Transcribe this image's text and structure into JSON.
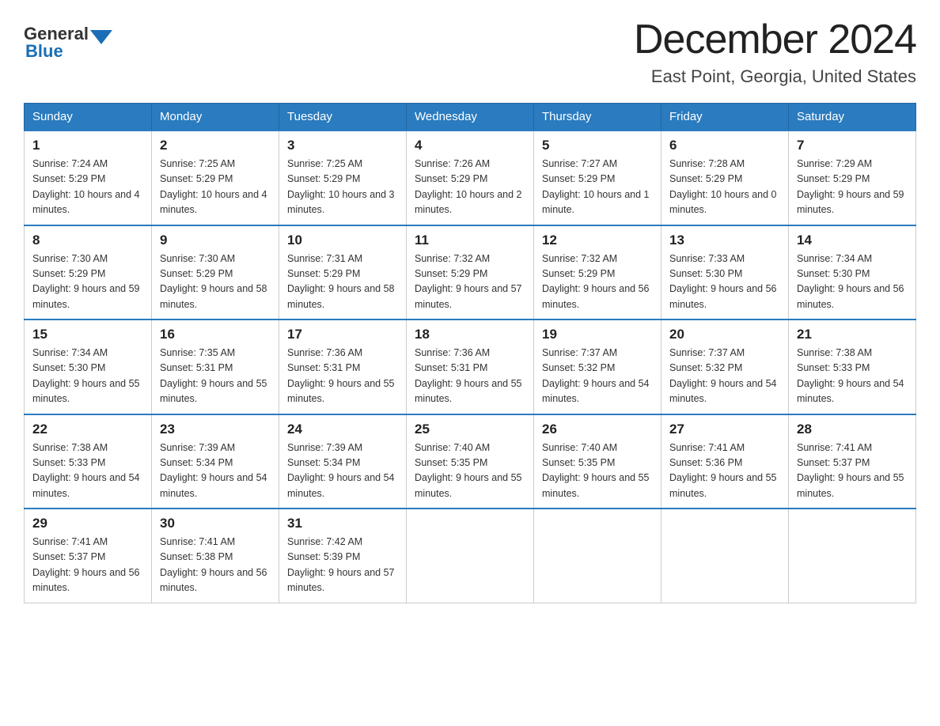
{
  "header": {
    "logo_general": "General",
    "logo_blue": "Blue",
    "month_title": "December 2024",
    "location": "East Point, Georgia, United States"
  },
  "days_of_week": [
    "Sunday",
    "Monday",
    "Tuesday",
    "Wednesday",
    "Thursday",
    "Friday",
    "Saturday"
  ],
  "weeks": [
    [
      {
        "day": "1",
        "sunrise": "7:24 AM",
        "sunset": "5:29 PM",
        "daylight": "10 hours and 4 minutes."
      },
      {
        "day": "2",
        "sunrise": "7:25 AM",
        "sunset": "5:29 PM",
        "daylight": "10 hours and 4 minutes."
      },
      {
        "day": "3",
        "sunrise": "7:25 AM",
        "sunset": "5:29 PM",
        "daylight": "10 hours and 3 minutes."
      },
      {
        "day": "4",
        "sunrise": "7:26 AM",
        "sunset": "5:29 PM",
        "daylight": "10 hours and 2 minutes."
      },
      {
        "day": "5",
        "sunrise": "7:27 AM",
        "sunset": "5:29 PM",
        "daylight": "10 hours and 1 minute."
      },
      {
        "day": "6",
        "sunrise": "7:28 AM",
        "sunset": "5:29 PM",
        "daylight": "10 hours and 0 minutes."
      },
      {
        "day": "7",
        "sunrise": "7:29 AM",
        "sunset": "5:29 PM",
        "daylight": "9 hours and 59 minutes."
      }
    ],
    [
      {
        "day": "8",
        "sunrise": "7:30 AM",
        "sunset": "5:29 PM",
        "daylight": "9 hours and 59 minutes."
      },
      {
        "day": "9",
        "sunrise": "7:30 AM",
        "sunset": "5:29 PM",
        "daylight": "9 hours and 58 minutes."
      },
      {
        "day": "10",
        "sunrise": "7:31 AM",
        "sunset": "5:29 PM",
        "daylight": "9 hours and 58 minutes."
      },
      {
        "day": "11",
        "sunrise": "7:32 AM",
        "sunset": "5:29 PM",
        "daylight": "9 hours and 57 minutes."
      },
      {
        "day": "12",
        "sunrise": "7:32 AM",
        "sunset": "5:29 PM",
        "daylight": "9 hours and 56 minutes."
      },
      {
        "day": "13",
        "sunrise": "7:33 AM",
        "sunset": "5:30 PM",
        "daylight": "9 hours and 56 minutes."
      },
      {
        "day": "14",
        "sunrise": "7:34 AM",
        "sunset": "5:30 PM",
        "daylight": "9 hours and 56 minutes."
      }
    ],
    [
      {
        "day": "15",
        "sunrise": "7:34 AM",
        "sunset": "5:30 PM",
        "daylight": "9 hours and 55 minutes."
      },
      {
        "day": "16",
        "sunrise": "7:35 AM",
        "sunset": "5:31 PM",
        "daylight": "9 hours and 55 minutes."
      },
      {
        "day": "17",
        "sunrise": "7:36 AM",
        "sunset": "5:31 PM",
        "daylight": "9 hours and 55 minutes."
      },
      {
        "day": "18",
        "sunrise": "7:36 AM",
        "sunset": "5:31 PM",
        "daylight": "9 hours and 55 minutes."
      },
      {
        "day": "19",
        "sunrise": "7:37 AM",
        "sunset": "5:32 PM",
        "daylight": "9 hours and 54 minutes."
      },
      {
        "day": "20",
        "sunrise": "7:37 AM",
        "sunset": "5:32 PM",
        "daylight": "9 hours and 54 minutes."
      },
      {
        "day": "21",
        "sunrise": "7:38 AM",
        "sunset": "5:33 PM",
        "daylight": "9 hours and 54 minutes."
      }
    ],
    [
      {
        "day": "22",
        "sunrise": "7:38 AM",
        "sunset": "5:33 PM",
        "daylight": "9 hours and 54 minutes."
      },
      {
        "day": "23",
        "sunrise": "7:39 AM",
        "sunset": "5:34 PM",
        "daylight": "9 hours and 54 minutes."
      },
      {
        "day": "24",
        "sunrise": "7:39 AM",
        "sunset": "5:34 PM",
        "daylight": "9 hours and 54 minutes."
      },
      {
        "day": "25",
        "sunrise": "7:40 AM",
        "sunset": "5:35 PM",
        "daylight": "9 hours and 55 minutes."
      },
      {
        "day": "26",
        "sunrise": "7:40 AM",
        "sunset": "5:35 PM",
        "daylight": "9 hours and 55 minutes."
      },
      {
        "day": "27",
        "sunrise": "7:41 AM",
        "sunset": "5:36 PM",
        "daylight": "9 hours and 55 minutes."
      },
      {
        "day": "28",
        "sunrise": "7:41 AM",
        "sunset": "5:37 PM",
        "daylight": "9 hours and 55 minutes."
      }
    ],
    [
      {
        "day": "29",
        "sunrise": "7:41 AM",
        "sunset": "5:37 PM",
        "daylight": "9 hours and 56 minutes."
      },
      {
        "day": "30",
        "sunrise": "7:41 AM",
        "sunset": "5:38 PM",
        "daylight": "9 hours and 56 minutes."
      },
      {
        "day": "31",
        "sunrise": "7:42 AM",
        "sunset": "5:39 PM",
        "daylight": "9 hours and 57 minutes."
      },
      null,
      null,
      null,
      null
    ]
  ]
}
